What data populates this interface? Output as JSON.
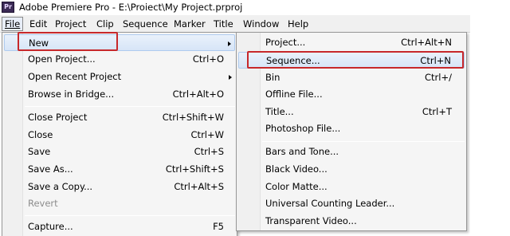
{
  "window": {
    "app_icon": "Pr",
    "title": "Adobe Premiere Pro - E:\\Proiect\\My Project.prproj"
  },
  "menubar": [
    {
      "label": "File",
      "active": true
    },
    {
      "label": "Edit"
    },
    {
      "label": "Project"
    },
    {
      "label": "Clip"
    },
    {
      "label": "Sequence"
    },
    {
      "label": "Marker"
    },
    {
      "label": "Title"
    },
    {
      "label": "Window"
    },
    {
      "label": "Help"
    }
  ],
  "file_menu": {
    "items": [
      {
        "label": "New",
        "shortcut": "",
        "submenu": true,
        "highlighted": true
      },
      {
        "label": "Open Project...",
        "shortcut": "Ctrl+O"
      },
      {
        "label": "Open Recent Project",
        "shortcut": "",
        "submenu": true
      },
      {
        "label": "Browse in Bridge...",
        "shortcut": "Ctrl+Alt+O"
      },
      {
        "label": "Close Project",
        "shortcut": "Ctrl+Shift+W"
      },
      {
        "label": "Close",
        "shortcut": "Ctrl+W"
      },
      {
        "label": "Save",
        "shortcut": "Ctrl+S"
      },
      {
        "label": "Save As...",
        "shortcut": "Ctrl+Shift+S"
      },
      {
        "label": "Save a Copy...",
        "shortcut": "Ctrl+Alt+S"
      },
      {
        "label": "Revert",
        "shortcut": "",
        "disabled": true
      },
      {
        "label": "Capture...",
        "shortcut": "F5"
      }
    ]
  },
  "new_submenu": {
    "items": [
      {
        "label": "Project...",
        "shortcut": "Ctrl+Alt+N"
      },
      {
        "label": "Sequence...",
        "shortcut": "Ctrl+N",
        "highlighted": true
      },
      {
        "label": "Bin",
        "shortcut": "Ctrl+/"
      },
      {
        "label": "Offline File...",
        "shortcut": ""
      },
      {
        "label": "Title...",
        "shortcut": "Ctrl+T"
      },
      {
        "label": "Photoshop File...",
        "shortcut": ""
      },
      {
        "label": "Bars and Tone...",
        "shortcut": ""
      },
      {
        "label": "Black Video...",
        "shortcut": ""
      },
      {
        "label": "Color Matte...",
        "shortcut": ""
      },
      {
        "label": "Universal Counting Leader...",
        "shortcut": ""
      },
      {
        "label": "Transparent Video...",
        "shortcut": ""
      }
    ]
  },
  "colors": {
    "annotation_box": "#c7282b",
    "highlight": "#d7e5f7"
  }
}
